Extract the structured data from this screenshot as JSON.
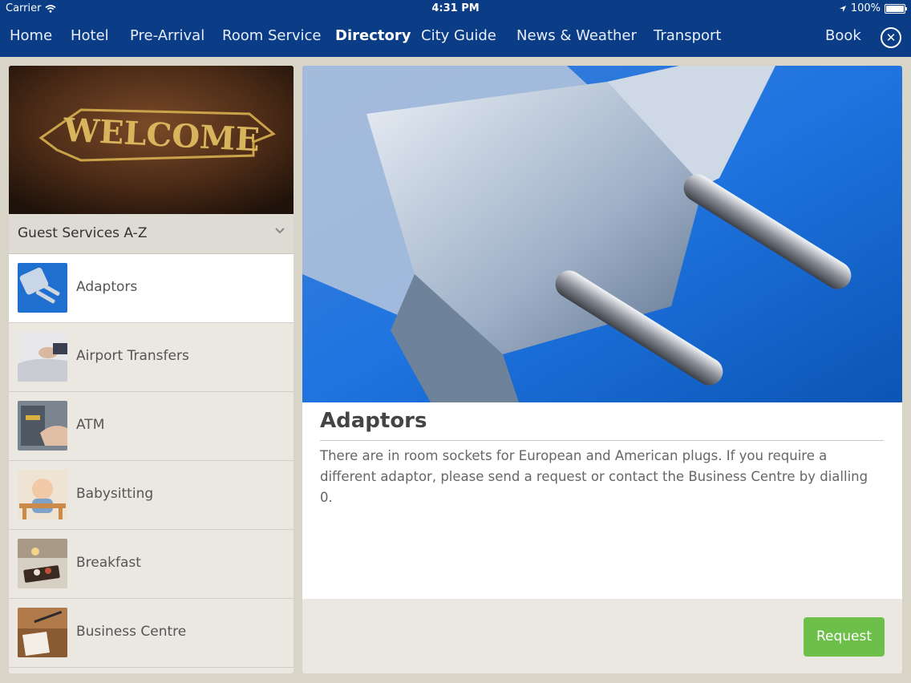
{
  "status_bar": {
    "carrier": "Carrier",
    "time": "4:31 PM",
    "battery": "100%"
  },
  "nav": {
    "items": [
      "Home",
      "Hotel",
      "Pre-Arrival",
      "Room Service",
      "Directory",
      "City Guide",
      "News & Weather",
      "Transport"
    ],
    "active": "Directory",
    "book_label": "Book"
  },
  "sidebar": {
    "banner_text": "WELCOME",
    "section_title": "Guest Services A-Z",
    "items": [
      {
        "label": "Adaptors",
        "selected": true
      },
      {
        "label": "Airport Transfers"
      },
      {
        "label": "ATM"
      },
      {
        "label": "Babysitting"
      },
      {
        "label": "Breakfast"
      },
      {
        "label": "Business Centre"
      }
    ]
  },
  "detail": {
    "title": "Adaptors",
    "body": "There are in room sockets for European and American plugs. If you require a different adaptor, please send a request or contact the Business Centre by dialling 0.",
    "request_label": "Request"
  },
  "colors": {
    "nav_bg": "#0b3c86",
    "button_green": "#6cc04a",
    "panel_bg": "#ebe8e2"
  }
}
